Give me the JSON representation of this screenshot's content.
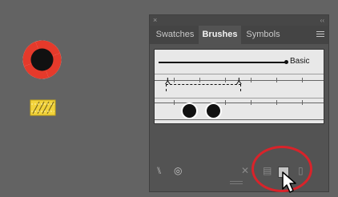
{
  "panel": {
    "close_glyph": "×",
    "collapse_glyph": "‹‹",
    "tabs": [
      {
        "label": "Swatches"
      },
      {
        "label": "Brushes",
        "active": true
      },
      {
        "label": "Symbols"
      }
    ]
  },
  "brushes": [
    {
      "kind": "calligraphic",
      "label": "Basic"
    },
    {
      "kind": "pattern",
      "label": ""
    },
    {
      "kind": "art",
      "label": ""
    }
  ],
  "toolbar": {
    "icons": [
      "brush-libraries-menu-icon",
      "libraries-panel-icon",
      "remove-brush-stroke-icon",
      "brush-options-icon",
      "new-brush-icon",
      "delete-brush-icon"
    ]
  },
  "colors": {
    "canvas": "#636363",
    "panel": "#535353",
    "highlight": "#d9232a",
    "lifebuoy_red": "#e53a2b"
  }
}
